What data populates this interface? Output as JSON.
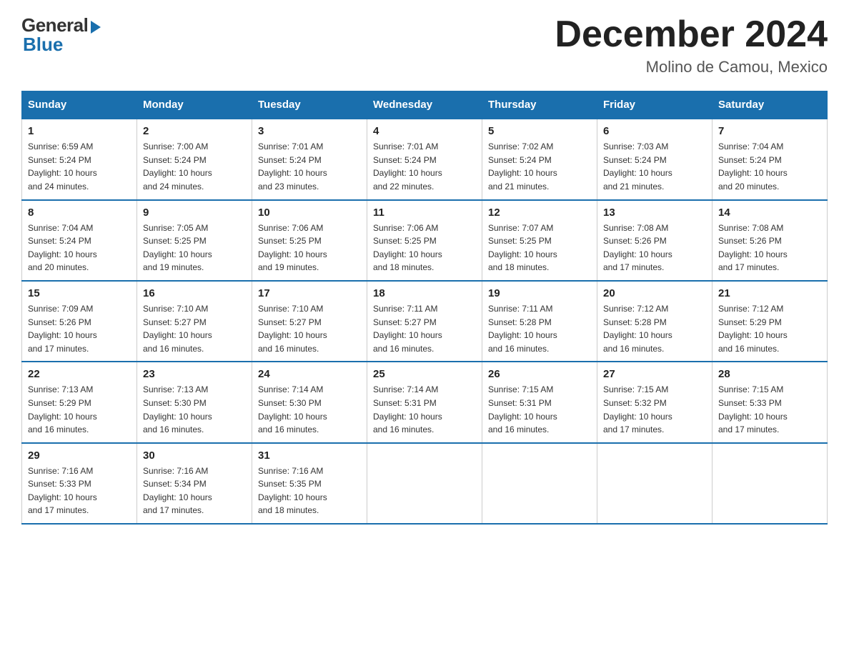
{
  "logo": {
    "general": "General",
    "blue": "Blue"
  },
  "title": "December 2024",
  "location": "Molino de Camou, Mexico",
  "days_of_week": [
    "Sunday",
    "Monday",
    "Tuesday",
    "Wednesday",
    "Thursday",
    "Friday",
    "Saturday"
  ],
  "weeks": [
    [
      {
        "day": "1",
        "info": "Sunrise: 6:59 AM\nSunset: 5:24 PM\nDaylight: 10 hours\nand 24 minutes."
      },
      {
        "day": "2",
        "info": "Sunrise: 7:00 AM\nSunset: 5:24 PM\nDaylight: 10 hours\nand 24 minutes."
      },
      {
        "day": "3",
        "info": "Sunrise: 7:01 AM\nSunset: 5:24 PM\nDaylight: 10 hours\nand 23 minutes."
      },
      {
        "day": "4",
        "info": "Sunrise: 7:01 AM\nSunset: 5:24 PM\nDaylight: 10 hours\nand 22 minutes."
      },
      {
        "day": "5",
        "info": "Sunrise: 7:02 AM\nSunset: 5:24 PM\nDaylight: 10 hours\nand 21 minutes."
      },
      {
        "day": "6",
        "info": "Sunrise: 7:03 AM\nSunset: 5:24 PM\nDaylight: 10 hours\nand 21 minutes."
      },
      {
        "day": "7",
        "info": "Sunrise: 7:04 AM\nSunset: 5:24 PM\nDaylight: 10 hours\nand 20 minutes."
      }
    ],
    [
      {
        "day": "8",
        "info": "Sunrise: 7:04 AM\nSunset: 5:24 PM\nDaylight: 10 hours\nand 20 minutes."
      },
      {
        "day": "9",
        "info": "Sunrise: 7:05 AM\nSunset: 5:25 PM\nDaylight: 10 hours\nand 19 minutes."
      },
      {
        "day": "10",
        "info": "Sunrise: 7:06 AM\nSunset: 5:25 PM\nDaylight: 10 hours\nand 19 minutes."
      },
      {
        "day": "11",
        "info": "Sunrise: 7:06 AM\nSunset: 5:25 PM\nDaylight: 10 hours\nand 18 minutes."
      },
      {
        "day": "12",
        "info": "Sunrise: 7:07 AM\nSunset: 5:25 PM\nDaylight: 10 hours\nand 18 minutes."
      },
      {
        "day": "13",
        "info": "Sunrise: 7:08 AM\nSunset: 5:26 PM\nDaylight: 10 hours\nand 17 minutes."
      },
      {
        "day": "14",
        "info": "Sunrise: 7:08 AM\nSunset: 5:26 PM\nDaylight: 10 hours\nand 17 minutes."
      }
    ],
    [
      {
        "day": "15",
        "info": "Sunrise: 7:09 AM\nSunset: 5:26 PM\nDaylight: 10 hours\nand 17 minutes."
      },
      {
        "day": "16",
        "info": "Sunrise: 7:10 AM\nSunset: 5:27 PM\nDaylight: 10 hours\nand 16 minutes."
      },
      {
        "day": "17",
        "info": "Sunrise: 7:10 AM\nSunset: 5:27 PM\nDaylight: 10 hours\nand 16 minutes."
      },
      {
        "day": "18",
        "info": "Sunrise: 7:11 AM\nSunset: 5:27 PM\nDaylight: 10 hours\nand 16 minutes."
      },
      {
        "day": "19",
        "info": "Sunrise: 7:11 AM\nSunset: 5:28 PM\nDaylight: 10 hours\nand 16 minutes."
      },
      {
        "day": "20",
        "info": "Sunrise: 7:12 AM\nSunset: 5:28 PM\nDaylight: 10 hours\nand 16 minutes."
      },
      {
        "day": "21",
        "info": "Sunrise: 7:12 AM\nSunset: 5:29 PM\nDaylight: 10 hours\nand 16 minutes."
      }
    ],
    [
      {
        "day": "22",
        "info": "Sunrise: 7:13 AM\nSunset: 5:29 PM\nDaylight: 10 hours\nand 16 minutes."
      },
      {
        "day": "23",
        "info": "Sunrise: 7:13 AM\nSunset: 5:30 PM\nDaylight: 10 hours\nand 16 minutes."
      },
      {
        "day": "24",
        "info": "Sunrise: 7:14 AM\nSunset: 5:30 PM\nDaylight: 10 hours\nand 16 minutes."
      },
      {
        "day": "25",
        "info": "Sunrise: 7:14 AM\nSunset: 5:31 PM\nDaylight: 10 hours\nand 16 minutes."
      },
      {
        "day": "26",
        "info": "Sunrise: 7:15 AM\nSunset: 5:31 PM\nDaylight: 10 hours\nand 16 minutes."
      },
      {
        "day": "27",
        "info": "Sunrise: 7:15 AM\nSunset: 5:32 PM\nDaylight: 10 hours\nand 17 minutes."
      },
      {
        "day": "28",
        "info": "Sunrise: 7:15 AM\nSunset: 5:33 PM\nDaylight: 10 hours\nand 17 minutes."
      }
    ],
    [
      {
        "day": "29",
        "info": "Sunrise: 7:16 AM\nSunset: 5:33 PM\nDaylight: 10 hours\nand 17 minutes."
      },
      {
        "day": "30",
        "info": "Sunrise: 7:16 AM\nSunset: 5:34 PM\nDaylight: 10 hours\nand 17 minutes."
      },
      {
        "day": "31",
        "info": "Sunrise: 7:16 AM\nSunset: 5:35 PM\nDaylight: 10 hours\nand 18 minutes."
      },
      {
        "day": "",
        "info": ""
      },
      {
        "day": "",
        "info": ""
      },
      {
        "day": "",
        "info": ""
      },
      {
        "day": "",
        "info": ""
      }
    ]
  ]
}
